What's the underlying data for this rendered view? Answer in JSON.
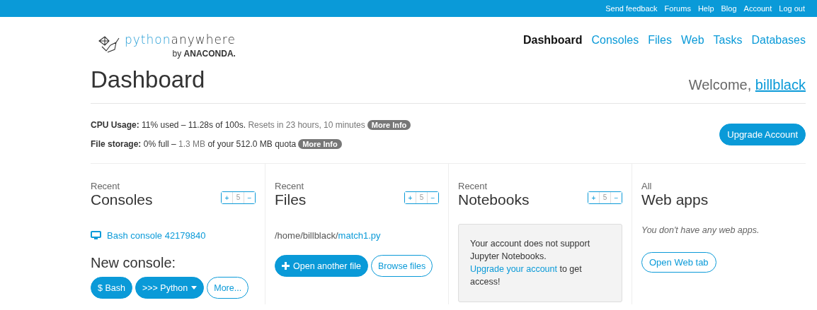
{
  "top_links": [
    "Send feedback",
    "Forums",
    "Help",
    "Blog",
    "Account",
    "Log out"
  ],
  "logo": {
    "name_parts": [
      "python",
      "anywhere"
    ],
    "byline": "by",
    "company": "ANACONDA."
  },
  "nav": [
    {
      "label": "Dashboard",
      "selected": true
    },
    {
      "label": "Consoles",
      "selected": false
    },
    {
      "label": "Files",
      "selected": false
    },
    {
      "label": "Web",
      "selected": false
    },
    {
      "label": "Tasks",
      "selected": false
    },
    {
      "label": "Databases",
      "selected": false
    }
  ],
  "page_title": "Dashboard",
  "welcome": {
    "text": "Welcome,",
    "user": "billblack"
  },
  "usage": [
    {
      "segments": [
        {
          "text": "CPU Usage:",
          "kind": "label"
        },
        {
          "text": "11% used – 11.28s of 100s.",
          "kind": "value"
        },
        {
          "text": "Resets in 23 hours, 10 minutes",
          "kind": "note"
        }
      ],
      "badge": "More Info"
    },
    {
      "segments": [
        {
          "text": "File storage:",
          "kind": "label"
        },
        {
          "text": "0% full –",
          "kind": "value"
        },
        {
          "text": "1.3 MB",
          "kind": "note"
        },
        {
          "text": "of your 512.0 MB quota",
          "kind": "value"
        }
      ],
      "badge": "More Info"
    }
  ],
  "upgrade_button": "Upgrade Account",
  "columns": [
    {
      "kind": "consoles",
      "kicker": "Recent",
      "title": "Consoles",
      "stepper": {
        "plus": "+",
        "count": "5",
        "minus": "−"
      },
      "items": [
        "Bash console 42179840"
      ],
      "new_heading": "New console:",
      "buttons": [
        {
          "label": "$ Bash",
          "kind": "primary",
          "caret": false
        },
        {
          "label": ">>> Python",
          "kind": "primary",
          "caret": true
        },
        {
          "label": "More...",
          "kind": "secondary",
          "caret": false
        }
      ]
    },
    {
      "kind": "files",
      "kicker": "Recent",
      "title": "Files",
      "stepper": {
        "plus": "+",
        "count": "5",
        "minus": "−"
      },
      "path": "/home/billblack/",
      "file": "match1.py",
      "buttons": [
        {
          "label": "Open another file",
          "kind": "primary",
          "plus_icon": true
        },
        {
          "label": "Browse files",
          "kind": "secondary",
          "plus_icon": false
        }
      ]
    },
    {
      "kind": "notebooks",
      "kicker": "Recent",
      "title": "Notebooks",
      "stepper": {
        "plus": "+",
        "count": "5",
        "minus": "−"
      },
      "notice": {
        "before": "Your account does not support Jupyter Notebooks.",
        "link": "Upgrade your account",
        "after": "to get access!"
      }
    },
    {
      "kind": "webapps",
      "kicker": "All",
      "title": "Web apps",
      "empty": "You don't have any web apps.",
      "button": "Open Web tab"
    }
  ]
}
